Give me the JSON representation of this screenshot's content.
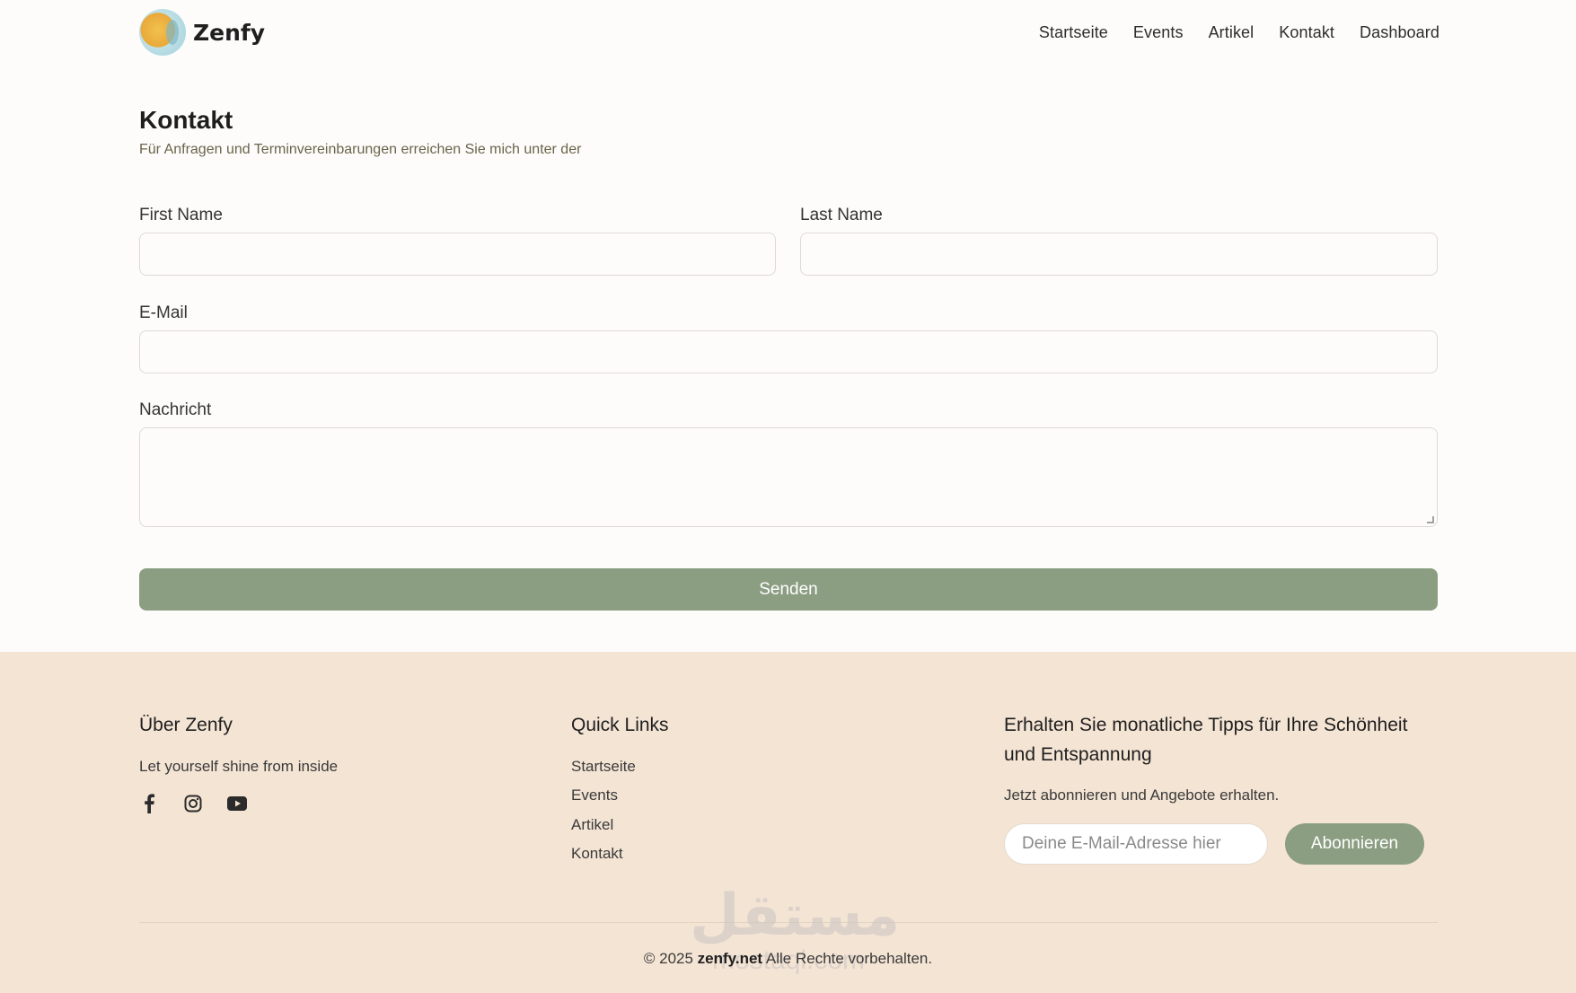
{
  "brand": {
    "name": "Zenfy"
  },
  "nav": {
    "items": [
      "Startseite",
      "Events",
      "Artikel",
      "Kontakt",
      "Dashboard"
    ]
  },
  "contact": {
    "title": "Kontakt",
    "subtitle": "Für Anfragen und Terminvereinbarungen erreichen Sie mich unter der",
    "first_name_label": "First Name",
    "last_name_label": "Last Name",
    "email_label": "E-Mail",
    "message_label": "Nachricht",
    "first_name_value": "",
    "last_name_value": "",
    "email_value": "",
    "message_value": "",
    "send_label": "Senden"
  },
  "footer": {
    "about_title": "Über Zenfy",
    "about_text": "Let yourself shine from inside",
    "social_icons": [
      "facebook-icon",
      "instagram-icon",
      "youtube-icon"
    ],
    "quick_links_title": "Quick Links",
    "quick_links": [
      "Startseite",
      "Events",
      "Artikel",
      "Kontakt"
    ],
    "newsletter_title": "Erhalten Sie monatliche Tipps für Ihre Schönheit und Entspannung",
    "newsletter_text": "Jetzt abonnieren und Angebote erhalten.",
    "newsletter_placeholder": "Deine E-Mail-Adresse hier",
    "subscribe_label": "Abonnieren",
    "copyright_prefix": "© 2025",
    "copyright_domain": "zenfy.net",
    "copyright_suffix": "Alle Rechte vorbehalten."
  },
  "watermark": {
    "arabic": "مستقل",
    "latin": "mostaql.com"
  },
  "colors": {
    "accent": "#8b9e82",
    "footer_bg": "#f4e4d4",
    "page_bg": "#fdfcfb"
  }
}
